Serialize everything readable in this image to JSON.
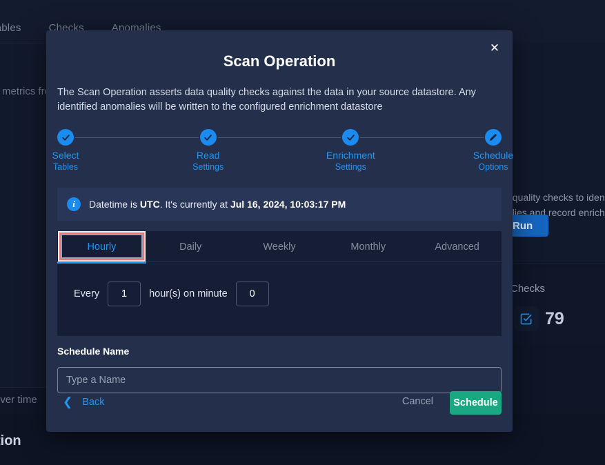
{
  "background": {
    "tabs": [
      {
        "label": "Tables"
      },
      {
        "label": "Checks"
      },
      {
        "label": "Anomalies"
      }
    ],
    "metrics_text": "w metrics fro",
    "desc_line1": ": quality checks to iden",
    "desc_line2": "alies and record enrichm",
    "run_label": "Run",
    "card_title": "Checks",
    "card_count": "79",
    "over_time_text": "over time",
    "heading_text": "tion"
  },
  "modal": {
    "close_label": "✕",
    "title": "Scan Operation",
    "description": "The Scan Operation asserts data quality checks against the data in your source datastore. Any identified anomalies will be written to the configured enrichment datastore",
    "stepper": {
      "steps": [
        {
          "icon": "check-icon",
          "line1": "Select",
          "line2": "Tables"
        },
        {
          "icon": "check-icon",
          "line1": "Read",
          "line2": "Settings"
        },
        {
          "icon": "check-icon",
          "line1": "Enrichment",
          "line2": "Settings"
        },
        {
          "icon": "pencil-icon",
          "line1": "Schedule",
          "line2": "Options"
        }
      ]
    },
    "info": {
      "icon": "info-icon",
      "prefix": "Datetime is ",
      "timezone": "UTC",
      "middle": ". It's currently at ",
      "datetime": "Jul 16, 2024, 10:03:17 PM"
    },
    "tabs": [
      {
        "label": "Hourly",
        "active": true
      },
      {
        "label": "Daily",
        "active": false
      },
      {
        "label": "Weekly",
        "active": false
      },
      {
        "label": "Monthly",
        "active": false
      },
      {
        "label": "Advanced",
        "active": false
      }
    ],
    "hourly": {
      "every_label": "Every",
      "hours_value": "1",
      "middle_label": "hour(s) on minute",
      "minute_value": "0"
    },
    "schedule_name": {
      "label": "Schedule Name",
      "value": "",
      "placeholder": "Type a Name"
    },
    "footer": {
      "back_label": "Back",
      "back_icon": "chevron-left-icon",
      "cancel_label": "Cancel",
      "schedule_label": "Schedule"
    }
  },
  "colors": {
    "modal_bg": "#232f4b",
    "accent_blue": "#2196f3",
    "info_bg": "#2a3657",
    "panel_bg": "#161e36",
    "focus_ring": "#f2736c",
    "schedule_green": "#1aa882",
    "run_blue": "#1565c0"
  }
}
